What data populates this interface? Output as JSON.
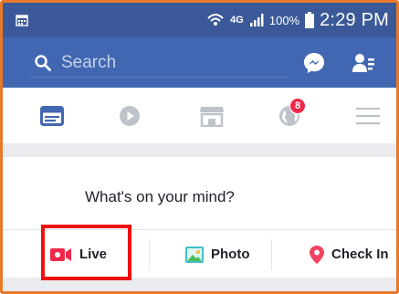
{
  "status_bar": {
    "network": "4G",
    "battery": "100%",
    "time": "2:29 PM"
  },
  "search": {
    "placeholder": "Search"
  },
  "nav": {
    "notifications_badge": "8"
  },
  "composer": {
    "prompt": "What's on your mind?"
  },
  "actions": {
    "live_label": "Live",
    "photo_label": "Photo",
    "checkin_label": "Check In"
  },
  "colors": {
    "status_bar": "#3b5998",
    "toolbar": "#4267b2",
    "live_red": "#f02849",
    "photo_green": "#44bec7",
    "checkin_pink": "#f3425f",
    "highlight": "#ee1111"
  }
}
